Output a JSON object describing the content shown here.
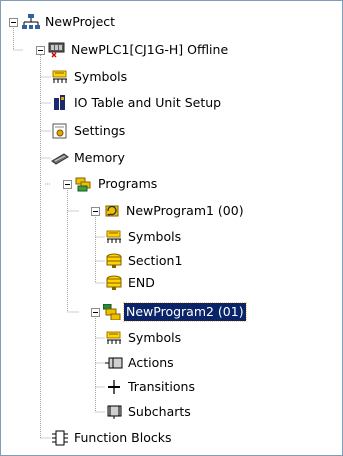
{
  "tree": {
    "project": {
      "label": "NewProject",
      "icon": "project-network-icon"
    },
    "plc": {
      "label": "NewPLC1[CJ1G-H] Offline",
      "icon": "plc-offline-icon"
    },
    "plc_children": [
      {
        "label": "Symbols",
        "icon": "symbols-icon"
      },
      {
        "label": "IO Table and Unit Setup",
        "icon": "io-table-icon"
      },
      {
        "label": "Settings",
        "icon": "settings-icon"
      },
      {
        "label": "Memory",
        "icon": "memory-icon"
      },
      {
        "label": "Programs",
        "icon": "programs-icon"
      }
    ],
    "program1": {
      "label": "NewProgram1 (00)",
      "icon": "program-icon",
      "children": [
        {
          "label": "Symbols",
          "icon": "symbols-icon"
        },
        {
          "label": "Section1",
          "icon": "section-icon"
        },
        {
          "label": "END",
          "icon": "section-icon"
        }
      ]
    },
    "program2": {
      "label": "NewProgram2 (01)",
      "icon": "sfc-program-icon",
      "children": [
        {
          "label": "Symbols",
          "icon": "symbols-icon"
        },
        {
          "label": "Actions",
          "icon": "actions-icon"
        },
        {
          "label": "Transitions",
          "icon": "transitions-icon"
        },
        {
          "label": "Subcharts",
          "icon": "subcharts-icon"
        }
      ]
    },
    "function_blocks": {
      "label": "Function Blocks",
      "icon": "function-blocks-icon"
    }
  },
  "colors": {
    "selection": "#0a246a",
    "border": "#7f9db9",
    "symbols": "#e0a800",
    "section": "#e8b800"
  }
}
